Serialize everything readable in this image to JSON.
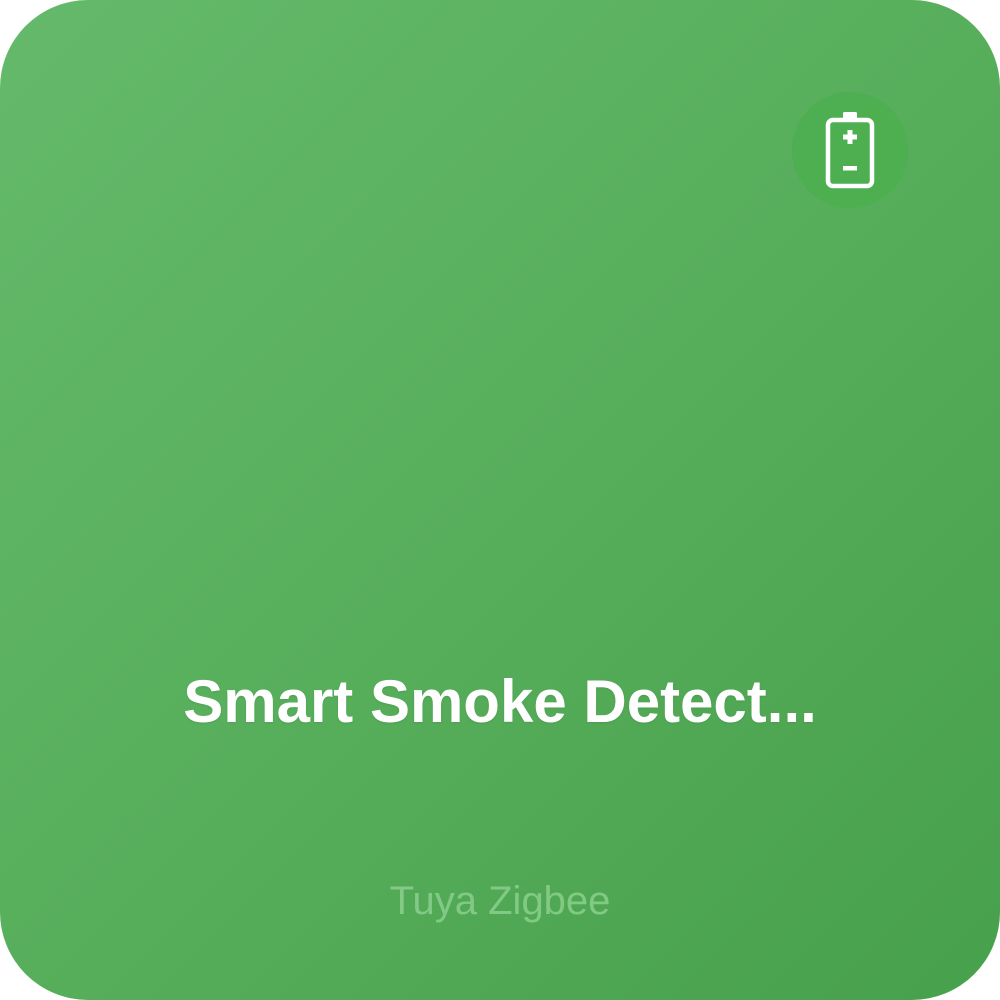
{
  "device": {
    "name": "Smart Smoke Detect...",
    "subtitle": "Tuya Zigbee"
  },
  "status": {
    "icon": "battery-icon"
  },
  "colors": {
    "card_background_start": "#64ba6a",
    "card_background_end": "#47a04b",
    "badge_background": "#4caf50",
    "title_text": "#ffffff",
    "subtitle_text": "#8fd291"
  }
}
